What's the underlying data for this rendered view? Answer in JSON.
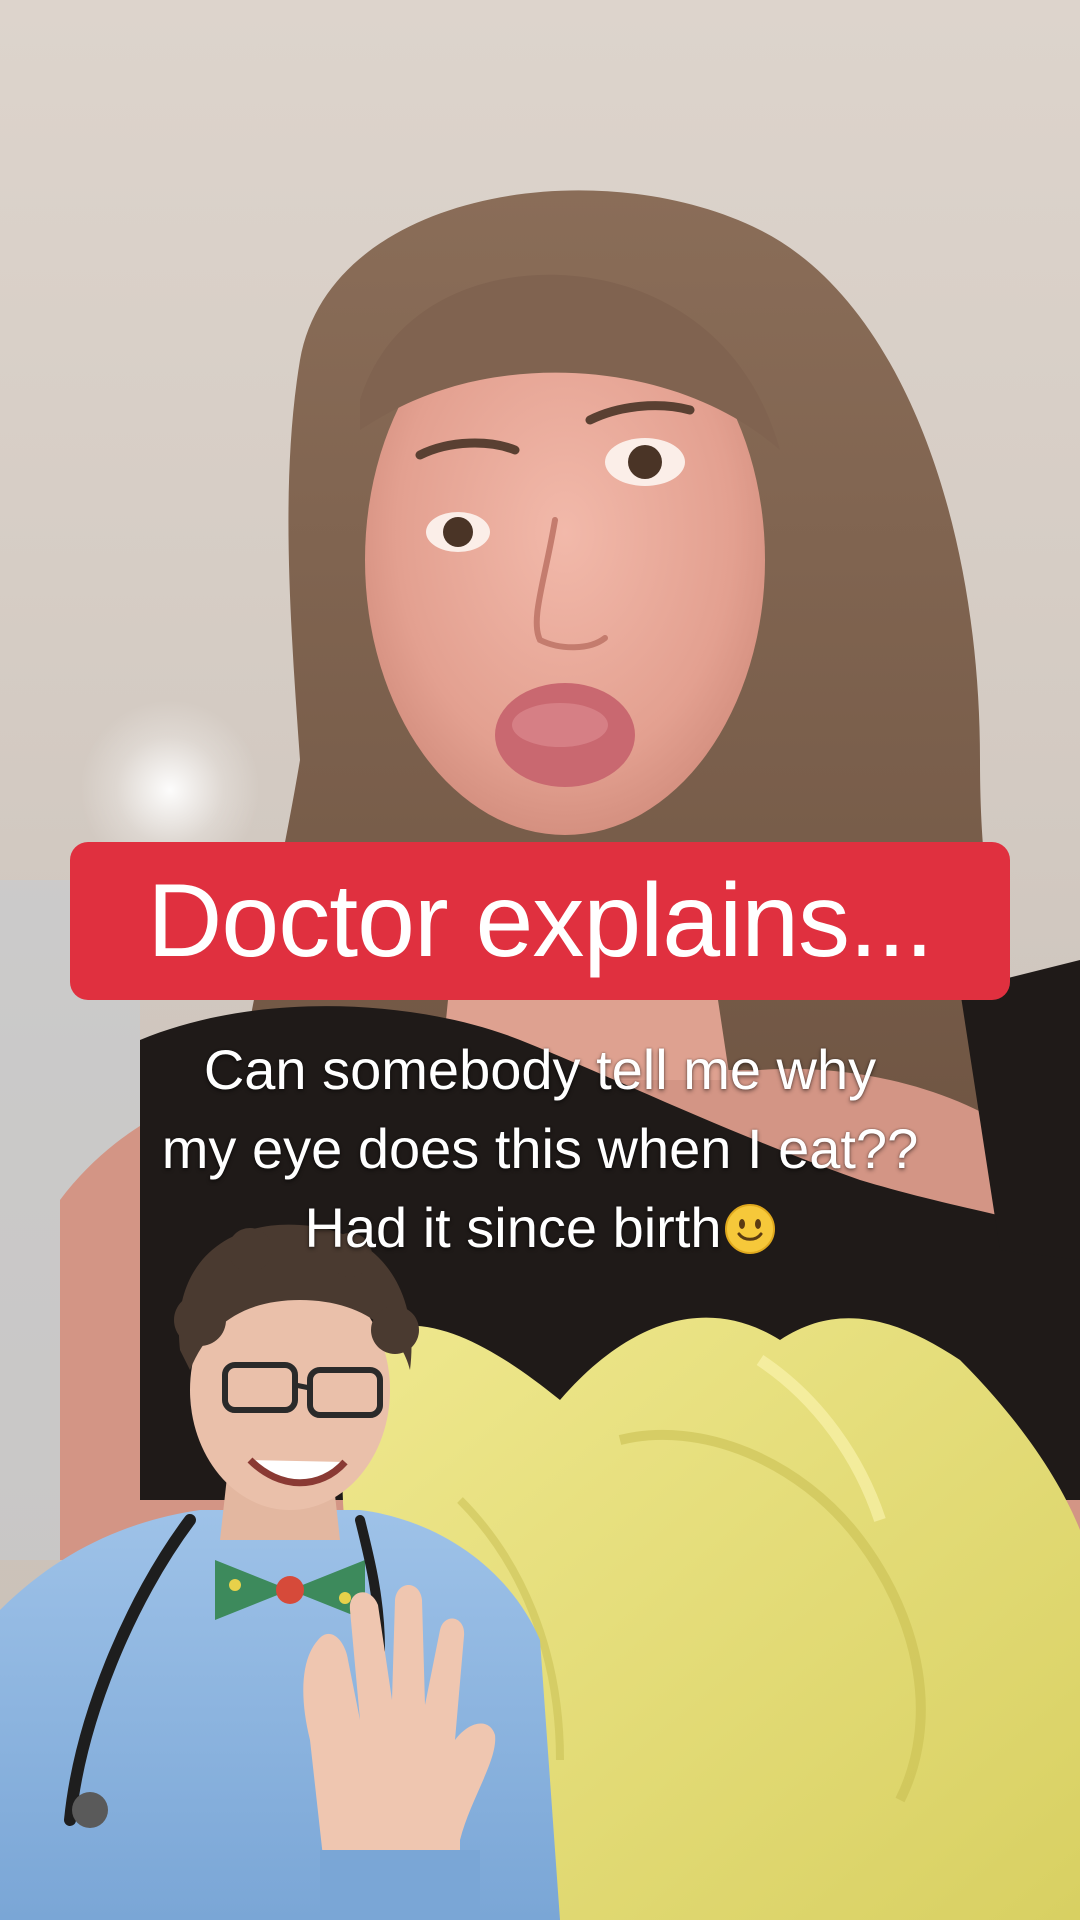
{
  "overlay": {
    "title": "Doctor explains..."
  },
  "caption": {
    "line1": "Can somebody tell me why",
    "line2": "my eye does this when I eat??",
    "line3": "Had it since birth",
    "emoji": "smiling-face-emoji"
  },
  "colors": {
    "banner": "#e0303f",
    "caption_text": "#ffffff",
    "dress": "#1f1a18",
    "tissue_paper": "#e6e07a",
    "doctor_shirt": "#8fb6e0"
  }
}
